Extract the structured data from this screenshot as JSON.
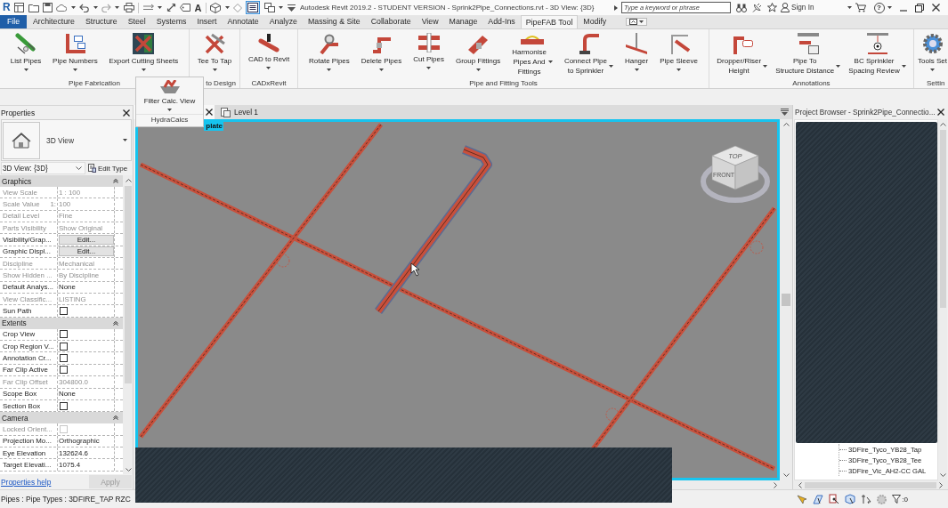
{
  "title_bar": {
    "logo": "R",
    "text_tool": "A",
    "thin_lines_on": true,
    "title": "Autodesk Revit 2019.2 - STUDENT VERSION - Sprink2Pipe_Connections.rvt - 3D View: {3D}",
    "search": {
      "placeholder": "Type a keyword or phrase"
    },
    "sign_in": "Sign In",
    "help": "?"
  },
  "ribbon_tabs": [
    {
      "label": "File",
      "kind": "application",
      "selected": false
    },
    {
      "label": "Architecture",
      "kind": "tab",
      "selected": false
    },
    {
      "label": "Structure",
      "kind": "tab",
      "selected": false
    },
    {
      "label": "Steel",
      "kind": "tab",
      "selected": false
    },
    {
      "label": "Systems",
      "kind": "tab",
      "selected": false
    },
    {
      "label": "Insert",
      "kind": "tab",
      "selected": false
    },
    {
      "label": "Annotate",
      "kind": "tab",
      "selected": false
    },
    {
      "label": "Analyze",
      "kind": "tab",
      "selected": false
    },
    {
      "label": "Massing & Site",
      "kind": "tab",
      "selected": false
    },
    {
      "label": "Collaborate",
      "kind": "tab",
      "selected": false
    },
    {
      "label": "View",
      "kind": "tab",
      "selected": false
    },
    {
      "label": "Manage",
      "kind": "tab",
      "selected": false
    },
    {
      "label": "Add-Ins",
      "kind": "tab",
      "selected": false
    },
    {
      "label": "PipeFAB Tool",
      "kind": "tab",
      "selected": true
    },
    {
      "label": "Modify",
      "kind": "tab",
      "selected": false
    }
  ],
  "ribbon_panels": [
    {
      "title": "Pipe Fabrication",
      "buttons": [
        {
          "label": "List Pipes"
        },
        {
          "label": "Pipe Numbers"
        },
        {
          "label": "Export Cutting Sheets"
        }
      ]
    },
    {
      "title": "to Design",
      "buttons": [
        {
          "label": "Tee To Tap"
        }
      ]
    },
    {
      "title": "CADxRevit",
      "buttons": [
        {
          "label": "CAD to Revit"
        }
      ]
    },
    {
      "title": "Pipe and Fitting Tools",
      "buttons": [
        {
          "label": "Rotate Pipes"
        },
        {
          "label": "Delete Pipes"
        },
        {
          "label": "Cut Pipes"
        },
        {
          "label": "Group Fittings"
        },
        {
          "label": "Harmonise\nPipes And\nFittings"
        },
        {
          "label": "Connect Pipe\nto Sprinkler"
        },
        {
          "label": "Hanger"
        },
        {
          "label": "Pipe Sleeve"
        }
      ]
    },
    {
      "title": "Annotations",
      "buttons": [
        {
          "label": "Dropper/Riser\nHeight"
        },
        {
          "label": "Pipe To\nStructure Distance"
        },
        {
          "label": "BC Sprinkler\nSpacing Review"
        }
      ]
    },
    {
      "title": "Settin",
      "buttons": [
        {
          "label": "Tools Set"
        }
      ]
    }
  ],
  "dropdown_panel": {
    "button": {
      "label": "Filter Calc. View"
    },
    "title": "HydraCalcs"
  },
  "properties": {
    "title": "Properties",
    "type_name": "3D View",
    "instance": "3D View: {3D}",
    "edit_type": "Edit Type",
    "sections": [
      {
        "title": "Graphics",
        "expanded": true,
        "rows": [
          {
            "label": "View Scale",
            "kind": "text",
            "value": "1 : 100",
            "disabled": true
          },
          {
            "label": "Scale Value",
            "suffix": "1:",
            "kind": "text",
            "value": "100",
            "disabled": true
          },
          {
            "label": "Detail Level",
            "kind": "text",
            "value": "Fine",
            "disabled": true
          },
          {
            "label": "Parts Visibility",
            "kind": "text",
            "value": "Show Original",
            "disabled": true
          },
          {
            "label": "Visibility/Grap...",
            "kind": "button",
            "value": "Edit...",
            "disabled": false
          },
          {
            "label": "Graphic Displ...",
            "kind": "button",
            "value": "Edit...",
            "disabled": false
          },
          {
            "label": "Discipline",
            "kind": "text",
            "value": "Mechanical",
            "disabled": true
          },
          {
            "label": "Show Hidden ...",
            "kind": "text",
            "value": "By Discipline",
            "disabled": true
          },
          {
            "label": "Default Analys...",
            "kind": "text",
            "value": "None",
            "disabled": false
          },
          {
            "label": "View Classific...",
            "kind": "text",
            "value": "LISTING",
            "disabled": true
          },
          {
            "label": "Sun Path",
            "kind": "checkbox",
            "checked": false,
            "disabled": false
          }
        ]
      },
      {
        "title": "Extents",
        "expanded": true,
        "rows": [
          {
            "label": "Crop View",
            "kind": "checkbox",
            "checked": false,
            "disabled": false
          },
          {
            "label": "Crop Region V...",
            "kind": "checkbox",
            "checked": false,
            "disabled": false
          },
          {
            "label": "Annotation Cr...",
            "kind": "checkbox",
            "checked": false,
            "disabled": false
          },
          {
            "label": "Far Clip Active",
            "kind": "checkbox",
            "checked": false,
            "disabled": false
          },
          {
            "label": "Far Clip Offset",
            "kind": "text",
            "value": "304800.0",
            "disabled": true
          },
          {
            "label": "Scope Box",
            "kind": "text",
            "value": "None",
            "disabled": false
          },
          {
            "label": "Section Box",
            "kind": "checkbox",
            "checked": false,
            "disabled": false
          }
        ]
      },
      {
        "title": "Camera",
        "expanded": true,
        "rows": [
          {
            "label": "Locked Orient...",
            "kind": "checkbox",
            "checked": false,
            "disabled": true
          },
          {
            "label": "Projection Mo...",
            "kind": "text",
            "value": "Orthographic",
            "disabled": false
          },
          {
            "label": "Eye Elevation",
            "kind": "text",
            "value": "132624.6",
            "disabled": false
          },
          {
            "label": "Target Elevati...",
            "kind": "text",
            "value": "1075.4",
            "disabled": false
          }
        ]
      }
    ],
    "help_link": "Properties help",
    "apply": {
      "label": "Apply",
      "disabled": true
    }
  },
  "view": {
    "tabs": [
      {
        "selected": true
      },
      {
        "label": "Level 1",
        "selected": false
      }
    ],
    "template_label": "plate",
    "view_cube": {
      "top": "TOP",
      "front": "FRONT"
    }
  },
  "project_browser": {
    "title": "Project Browser - Sprink2Pipe_Connectio...",
    "visible_items": [
      {
        "label": "3DFire_Tyco_YB28_Tap"
      },
      {
        "label": "3DFire_Tyco_YB28_Tee"
      },
      {
        "label": "3DFire_Vic_AH2-CC GAL"
      }
    ]
  },
  "status_bar": {
    "text": "Pipes : Pipe Types : 3DFIRE_TAP RZC",
    "filter_count": ":0"
  }
}
